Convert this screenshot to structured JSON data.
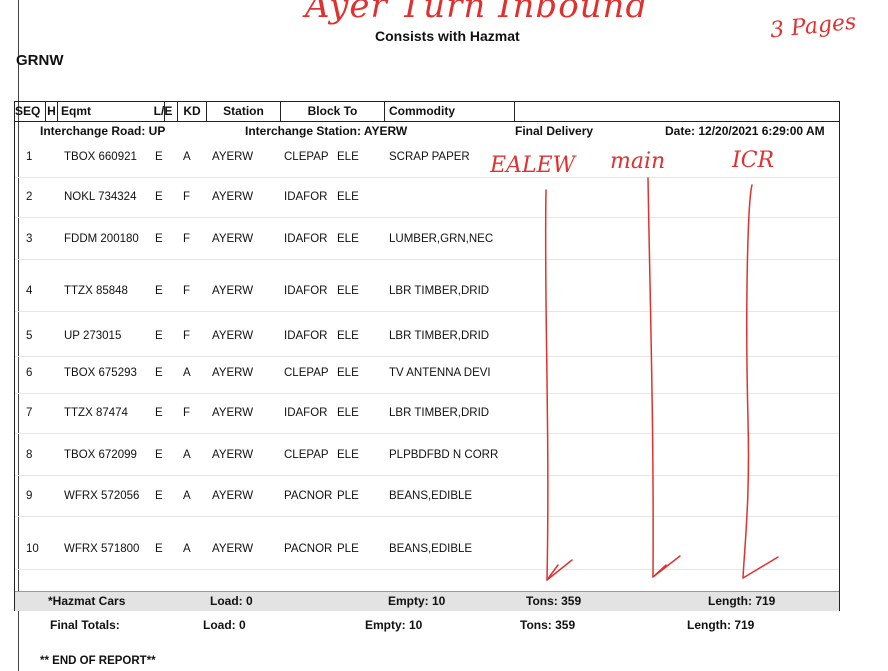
{
  "handwritten": {
    "title": "Ayer Turn Inbound",
    "pages": "3 Pages",
    "col1": "EALEW",
    "col2": "main",
    "col3": "ICR"
  },
  "header": {
    "subtitle": "Consists with Hazmat",
    "railroad": "GRNW"
  },
  "columns": {
    "seq": "SEQ",
    "h": "H",
    "eqmt": "Eqmt",
    "le": "L/E",
    "kd": "KD",
    "station": "Station",
    "block_to": "Block To",
    "commodity": "Commodity"
  },
  "summary": {
    "interchange_road": "Interchange Road: UP",
    "interchange_station": "Interchange Station: AYERW",
    "final_delivery": "Final Delivery",
    "date": "Date: 12/20/2021 6:29:00 AM"
  },
  "rows": [
    {
      "seq": "1",
      "eqmt": "TBOX 660921",
      "le": "E",
      "kd": "A",
      "station": "AYERW",
      "block": "CLEPAP",
      "blk2": "ELE",
      "commodity": "SCRAP PAPER"
    },
    {
      "seq": "2",
      "eqmt": "NOKL 734324",
      "le": "E",
      "kd": "F",
      "station": "AYERW",
      "block": "IDAFOR",
      "blk2": "ELE",
      "commodity": ""
    },
    {
      "seq": "3",
      "eqmt": "FDDM 200180",
      "le": "E",
      "kd": "F",
      "station": "AYERW",
      "block": "IDAFOR",
      "blk2": "ELE",
      "commodity": "LUMBER,GRN,NEC"
    },
    {
      "seq": "4",
      "eqmt": "TTZX 85848",
      "le": "E",
      "kd": "F",
      "station": "AYERW",
      "block": "IDAFOR",
      "blk2": "ELE",
      "commodity": "LBR TIMBER,DRID"
    },
    {
      "seq": "5",
      "eqmt": "UP  273015",
      "le": "E",
      "kd": "F",
      "station": "AYERW",
      "block": "IDAFOR",
      "blk2": "ELE",
      "commodity": "LBR TIMBER,DRID"
    },
    {
      "seq": "6",
      "eqmt": "TBOX 675293",
      "le": "E",
      "kd": "A",
      "station": "AYERW",
      "block": "CLEPAP",
      "blk2": "ELE",
      "commodity": "TV ANTENNA DEVI"
    },
    {
      "seq": "7",
      "eqmt": "TTZX 87474",
      "le": "E",
      "kd": "F",
      "station": "AYERW",
      "block": "IDAFOR",
      "blk2": "ELE",
      "commodity": "LBR TIMBER,DRID"
    },
    {
      "seq": "8",
      "eqmt": "TBOX 672099",
      "le": "E",
      "kd": "A",
      "station": "AYERW",
      "block": "CLEPAP",
      "blk2": "ELE",
      "commodity": "PLPBDFBD N CORR"
    },
    {
      "seq": "9",
      "eqmt": "WFRX 572056",
      "le": "E",
      "kd": "A",
      "station": "AYERW",
      "block": "PACNOR",
      "blk2": "PLE",
      "commodity": "BEANS,EDIBLE"
    },
    {
      "seq": "10",
      "eqmt": "WFRX 571800",
      "le": "E",
      "kd": "A",
      "station": "AYERW",
      "block": "PACNOR",
      "blk2": "PLE",
      "commodity": "BEANS,EDIBLE"
    }
  ],
  "hazmat": {
    "label": "*Hazmat Cars",
    "load": "Load: 0",
    "empty": "Empty: 10",
    "tons": "Tons: 359",
    "length": "Length: 719"
  },
  "finals": {
    "label": "Final Totals:",
    "load": "Load: 0",
    "empty": "Empty: 10",
    "tons": "Tons: 359",
    "length": "Length: 719"
  },
  "footer": {
    "end": "** END OF REPORT**"
  },
  "colors": {
    "ink_red": "#e03131",
    "shade": "#e3e3e3"
  }
}
